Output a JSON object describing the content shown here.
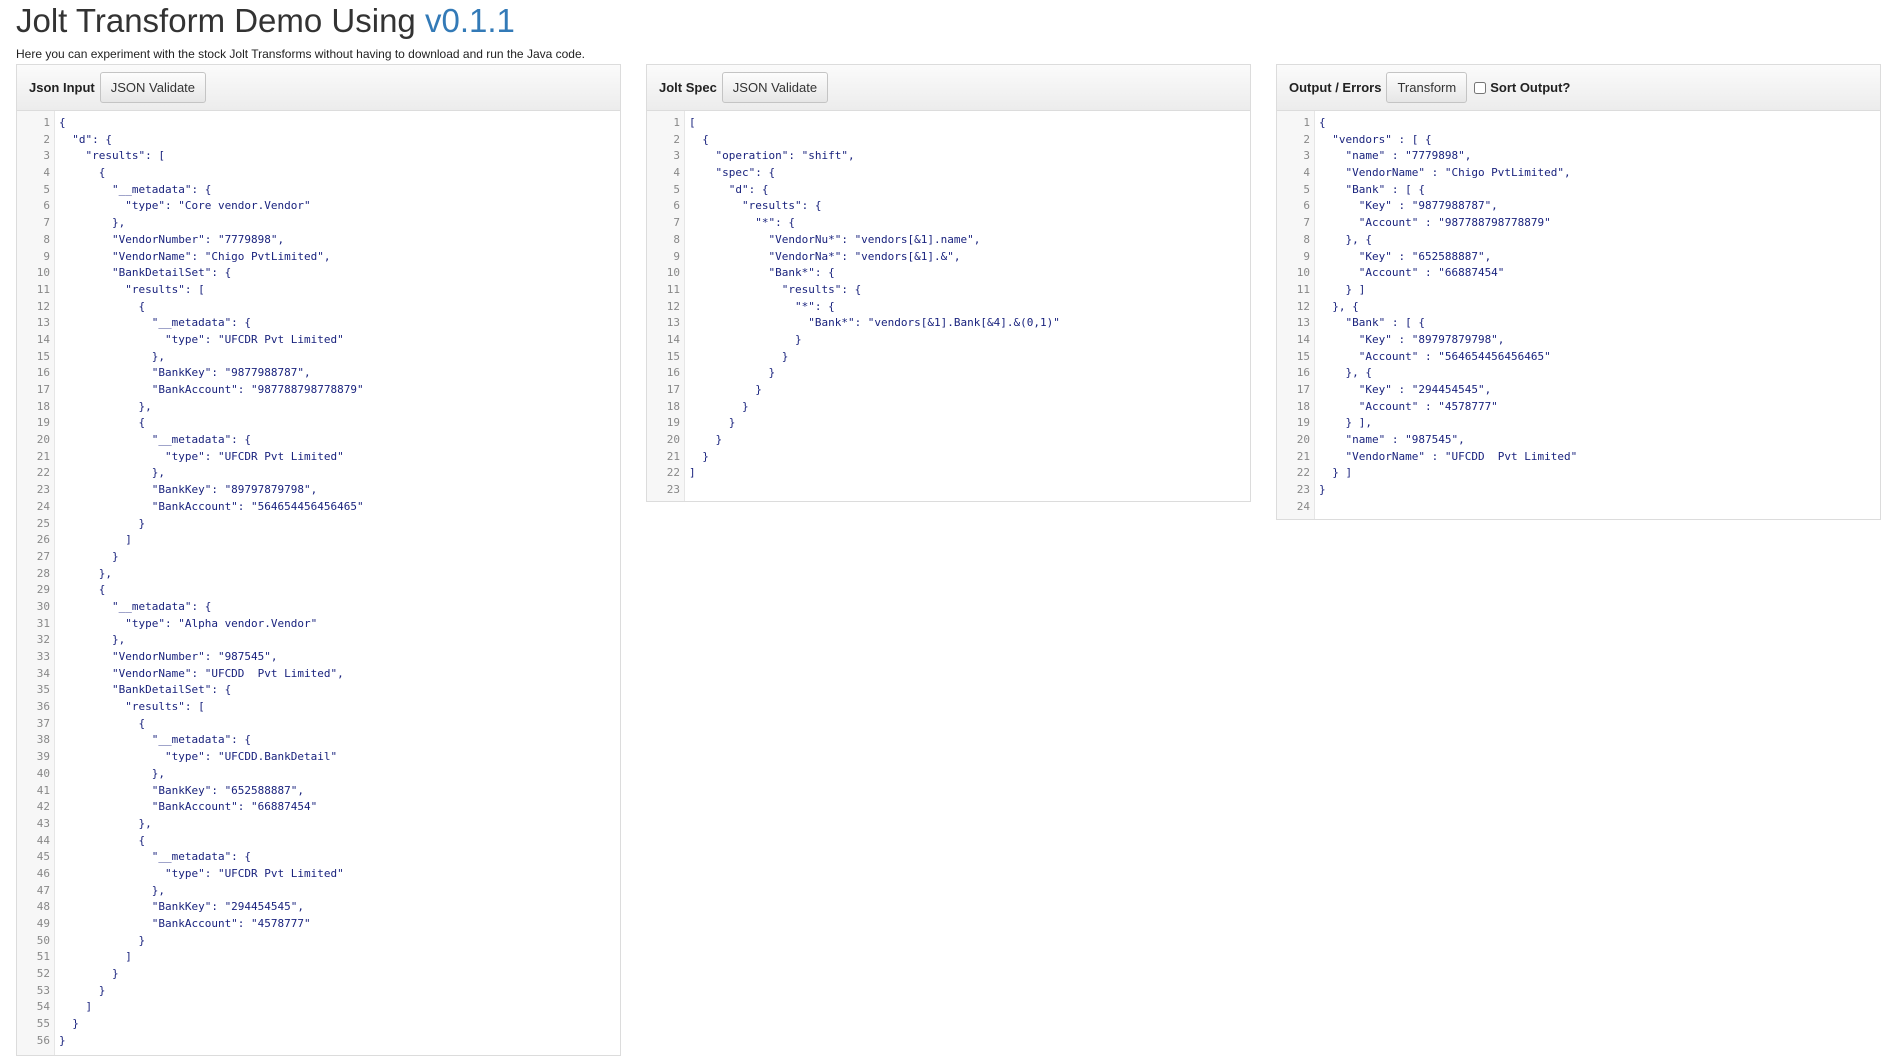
{
  "page": {
    "title_main": "Jolt Transform Demo Using ",
    "title_version": "v0.1.1",
    "subtitle": "Here you can experiment with the stock Jolt Transforms without having to download and run the Java code."
  },
  "panels": {
    "input": {
      "title": "Json Input",
      "button": "JSON Validate",
      "lines": [
        "{",
        "  \"d\": {",
        "    \"results\": [",
        "      {",
        "        \"__metadata\": {",
        "          \"type\": \"Core vendor.Vendor\"",
        "        },",
        "        \"VendorNumber\": \"7779898\",",
        "        \"VendorName\": \"Chigo PvtLimited\",",
        "        \"BankDetailSet\": {",
        "          \"results\": [",
        "            {",
        "              \"__metadata\": {",
        "                \"type\": \"UFCDR Pvt Limited\"",
        "              },",
        "              \"BankKey\": \"9877988787\",",
        "              \"BankAccount\": \"987788798778879\"",
        "            },",
        "            {",
        "              \"__metadata\": {",
        "                \"type\": \"UFCDR Pvt Limited\"",
        "              },",
        "              \"BankKey\": \"89797879798\",",
        "              \"BankAccount\": \"564654456456465\"",
        "            }",
        "          ]",
        "        }",
        "      },",
        "      {",
        "        \"__metadata\": {",
        "          \"type\": \"Alpha vendor.Vendor\"",
        "        },",
        "        \"VendorNumber\": \"987545\",",
        "        \"VendorName\": \"UFCDD  Pvt Limited\",",
        "        \"BankDetailSet\": {",
        "          \"results\": [",
        "            {",
        "              \"__metadata\": {",
        "                \"type\": \"UFCDD.BankDetail\"",
        "              },",
        "              \"BankKey\": \"652588887\",",
        "              \"BankAccount\": \"66887454\"",
        "            },",
        "            {",
        "              \"__metadata\": {",
        "                \"type\": \"UFCDR Pvt Limited\"",
        "              },",
        "              \"BankKey\": \"294454545\",",
        "              \"BankAccount\": \"4578777\"",
        "            }",
        "          ]",
        "        }",
        "      }",
        "    ]",
        "  }",
        "}"
      ]
    },
    "spec": {
      "title": "Jolt Spec",
      "button": "JSON Validate",
      "lines": [
        "[",
        "  {",
        "    \"operation\": \"shift\",",
        "    \"spec\": {",
        "      \"d\": {",
        "        \"results\": {",
        "          \"*\": {",
        "            \"VendorNu*\": \"vendors[&1].name\",",
        "            \"VendorNa*\": \"vendors[&1].&\",",
        "            \"Bank*\": {",
        "              \"results\": {",
        "                \"*\": {",
        "                  \"Bank*\": \"vendors[&1].Bank[&4].&(0,1)\"",
        "                }",
        "              }",
        "            }",
        "          }",
        "        }",
        "      }",
        "    }",
        "  }",
        "]",
        ""
      ]
    },
    "output": {
      "title": "Output / Errors",
      "button": "Transform",
      "sort_label": "Sort Output?",
      "lines": [
        "{",
        "  \"vendors\" : [ {",
        "    \"name\" : \"7779898\",",
        "    \"VendorName\" : \"Chigo PvtLimited\",",
        "    \"Bank\" : [ {",
        "      \"Key\" : \"9877988787\",",
        "      \"Account\" : \"987788798778879\"",
        "    }, {",
        "      \"Key\" : \"652588887\",",
        "      \"Account\" : \"66887454\"",
        "    } ]",
        "  }, {",
        "    \"Bank\" : [ {",
        "      \"Key\" : \"89797879798\",",
        "      \"Account\" : \"564654456456465\"",
        "    }, {",
        "      \"Key\" : \"294454545\",",
        "      \"Account\" : \"4578777\"",
        "    } ],",
        "    \"name\" : \"987545\",",
        "    \"VendorName\" : \"UFCDD  Pvt Limited\"",
        "  } ]",
        "}",
        ""
      ]
    }
  }
}
